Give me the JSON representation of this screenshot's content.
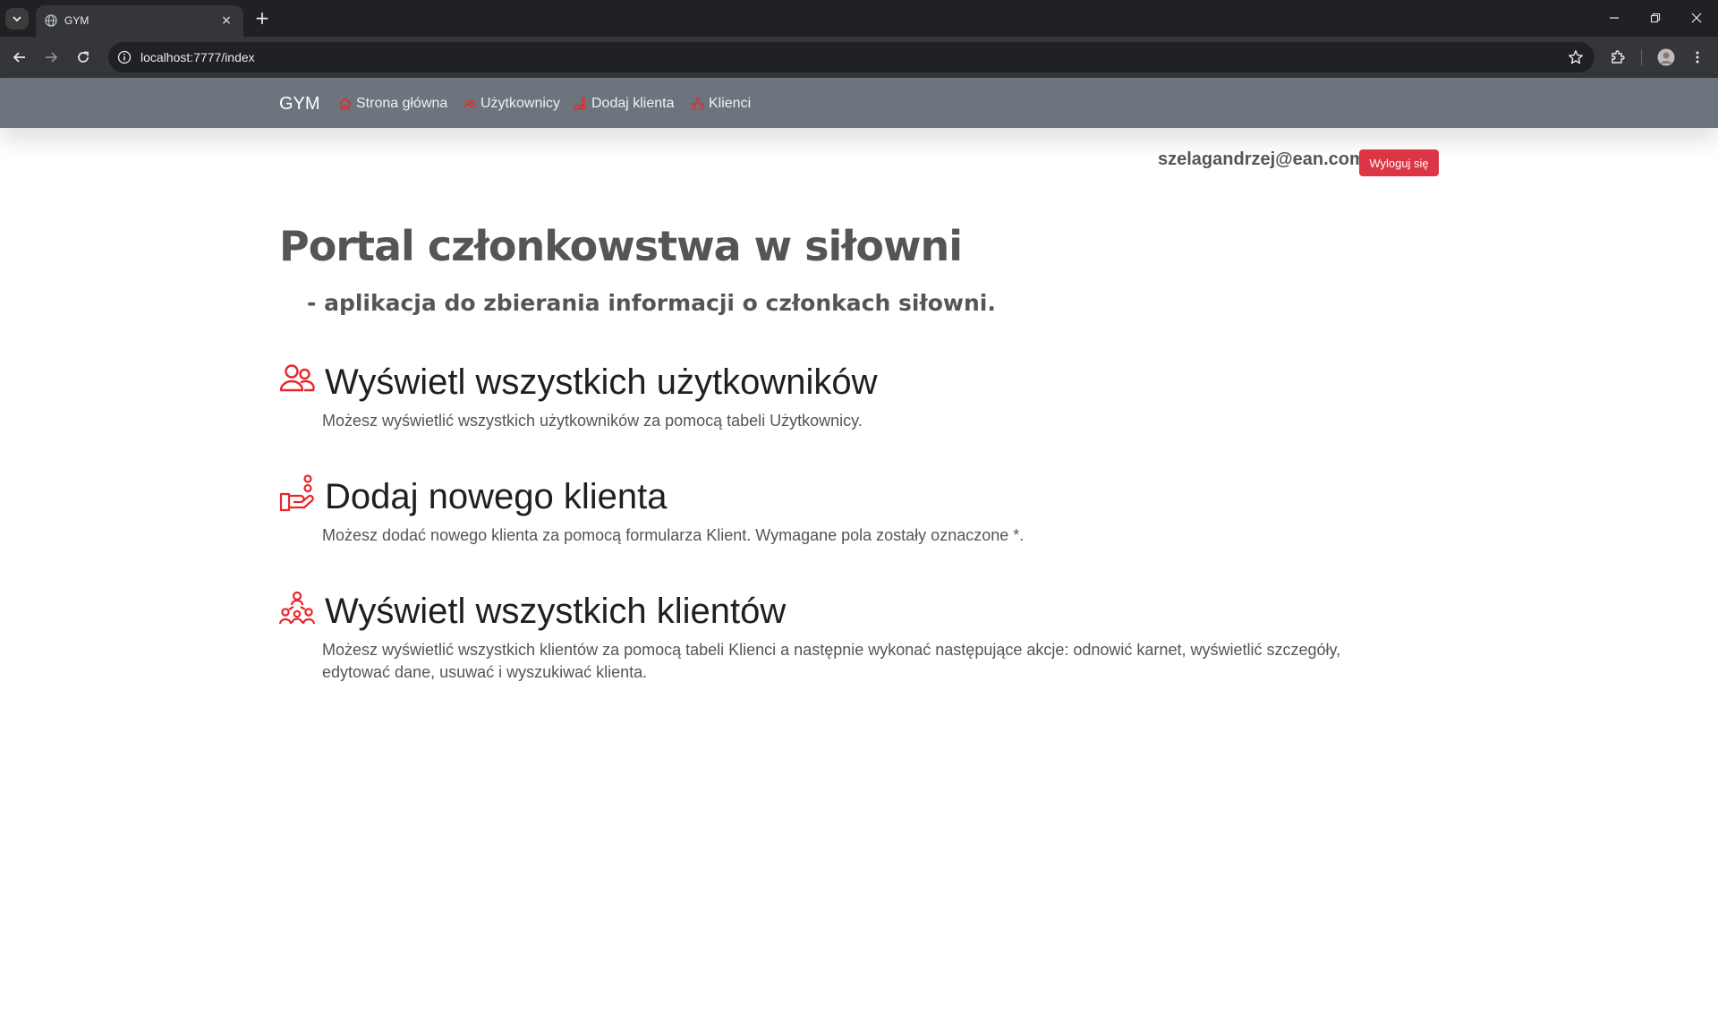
{
  "browser": {
    "tab_title": "GYM",
    "url": "localhost:7777/index",
    "tab_close_symbol": "×",
    "new_tab_symbol": "+"
  },
  "navbar": {
    "brand": "GYM",
    "items": [
      {
        "label": "Strona główna",
        "icon": "home-icon"
      },
      {
        "label": "Użytkownicy",
        "icon": "users-icon"
      },
      {
        "label": "Dodaj klienta",
        "icon": "add-client-icon"
      },
      {
        "label": "Klienci",
        "icon": "clients-icon"
      }
    ]
  },
  "user": {
    "email": "szelagandrzej@ean.com",
    "logout_label": "Wyloguj się"
  },
  "main": {
    "title": "Portal członkowstwa w siłowni",
    "subtitle": "- aplikacja do zbierania informacji o członkach siłowni.",
    "sections": [
      {
        "heading": "Wyświetl wszystkich użytkowników",
        "description": "Możesz wyświetlić wszystkich użytkowników za pomocą tabeli Użytkownicy.",
        "icon": "users-icon"
      },
      {
        "heading": "Dodaj nowego klienta",
        "description": "Możesz dodać nowego klienta za pomocą formularza Klient. Wymagane pola zostały oznaczone *.",
        "icon": "add-client-icon"
      },
      {
        "heading": "Wyświetl wszystkich klientów",
        "description": "Możesz wyświetlić wszystkich klientów za pomocą tabeli Klienci a następnie wykonać następujące akcje: odnowić karnet, wyświetlić szczegóły, edytować dane, usuwać i wyszukiwać klienta.",
        "icon": "clients-icon"
      }
    ]
  },
  "colors": {
    "accent_red": "#dc3545",
    "icon_red": "#e8262b",
    "navbar_bg": "#6c757d",
    "chrome_dark": "#202124",
    "chrome_toolbar": "#35363a"
  }
}
